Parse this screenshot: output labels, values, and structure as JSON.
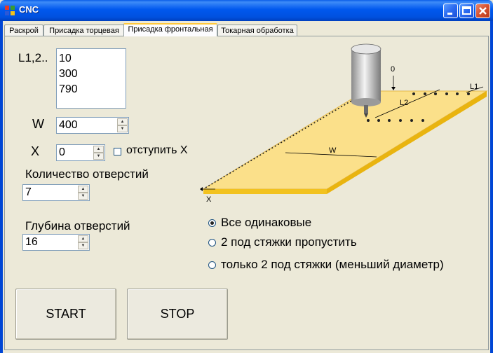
{
  "window": {
    "title": "CNC"
  },
  "tabs": [
    {
      "label": "Раскрой"
    },
    {
      "label": "Присадка торцевая"
    },
    {
      "label": "Присадка фронтальная",
      "active": true
    },
    {
      "label": "Токарная обработка"
    }
  ],
  "lengths": {
    "label": "L1,2..",
    "values": [
      "10",
      "300",
      "790"
    ]
  },
  "width": {
    "label": "W",
    "value": "400"
  },
  "offset_x": {
    "label": "X",
    "value": "0",
    "checkbox_label": "отступить X",
    "checked": false
  },
  "holes_count": {
    "label": "Количество отверстий",
    "value": "7"
  },
  "holes_depth": {
    "label": "Глубина отверстий",
    "value": "16"
  },
  "diagram": {
    "zero": "0",
    "l1": "L1",
    "l2": "L2",
    "w": "W",
    "x": "X"
  },
  "options": [
    {
      "label": "Все одинаковые",
      "checked": true
    },
    {
      "label": "2 под стяжки пропустить",
      "checked": false
    },
    {
      "label": "только 2 под стяжки (меньший диаметр)",
      "checked": false
    }
  ],
  "buttons": {
    "start": "START",
    "stop": "STOP"
  }
}
